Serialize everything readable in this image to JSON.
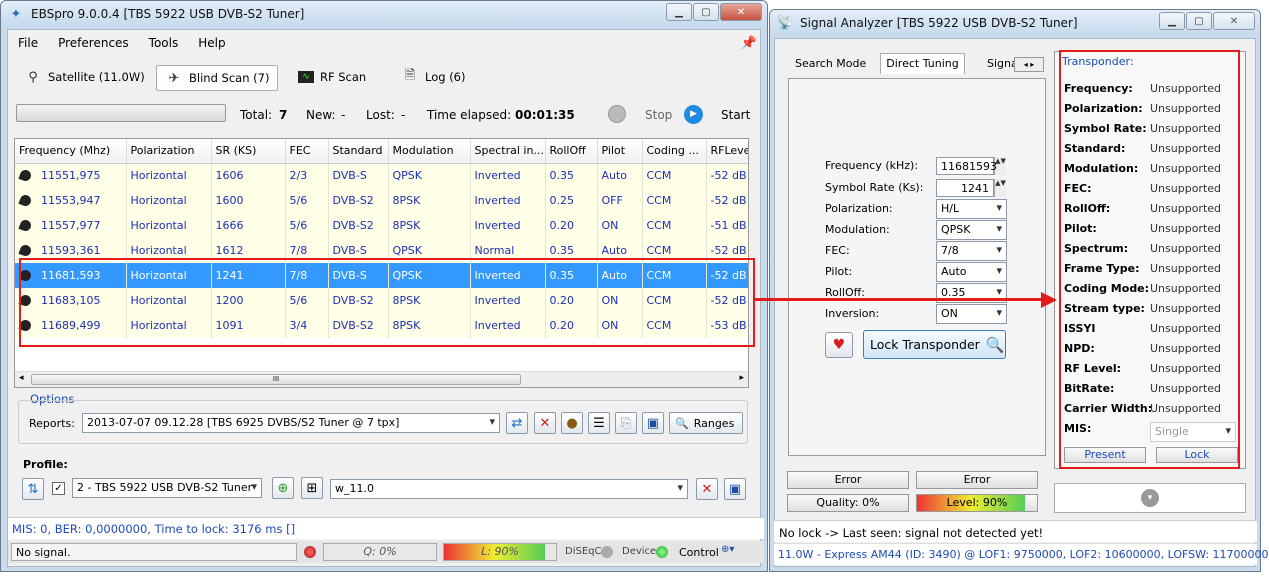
{
  "left": {
    "title": "EBSpro 9.0.0.4 [TBS 5922 USB DVB-S2 Tuner]",
    "menu": [
      "File",
      "Preferences",
      "Tools",
      "Help"
    ],
    "tabs": [
      {
        "label": "Satellite (11.0W)"
      },
      {
        "label": "Blind Scan (7)"
      },
      {
        "label": "RF Scan"
      },
      {
        "label": "Log (6)"
      }
    ],
    "scan": {
      "total_label": "Total:",
      "total": "7",
      "new_label": "New:",
      "new": "-",
      "lost_label": "Lost:",
      "lost": "-",
      "elapsed_label": "Time elapsed:",
      "elapsed": "00:01:35",
      "stop": "Stop",
      "start": "Start"
    },
    "columns": [
      "Frequency (Mhz)",
      "Polarization",
      "SR (KS)",
      "FEC",
      "Standard",
      "Modulation",
      "Spectral in...",
      "RollOff",
      "Pilot",
      "Coding ...",
      "RFLeve"
    ],
    "rows": [
      [
        "11551,975",
        "Horizontal",
        "1606",
        "2/3",
        "DVB-S",
        "QPSK",
        "Inverted",
        "0.35",
        "Auto",
        "CCM",
        "-52 dB"
      ],
      [
        "11553,947",
        "Horizontal",
        "1600",
        "5/6",
        "DVB-S2",
        "8PSK",
        "Inverted",
        "0.25",
        "OFF",
        "CCM",
        "-52 dB"
      ],
      [
        "11557,977",
        "Horizontal",
        "1666",
        "5/6",
        "DVB-S2",
        "8PSK",
        "Inverted",
        "0.20",
        "ON",
        "CCM",
        "-51 dB"
      ],
      [
        "11593,361",
        "Horizontal",
        "1612",
        "7/8",
        "DVB-S",
        "QPSK",
        "Normal",
        "0.35",
        "Auto",
        "CCM",
        "-52 dB"
      ],
      [
        "11681,593",
        "Horizontal",
        "1241",
        "7/8",
        "DVB-S",
        "QPSK",
        "Inverted",
        "0.35",
        "Auto",
        "CCM",
        "-52 dB"
      ],
      [
        "11683,105",
        "Horizontal",
        "1200",
        "5/6",
        "DVB-S2",
        "8PSK",
        "Inverted",
        "0.20",
        "ON",
        "CCM",
        "-52 dB"
      ],
      [
        "11689,499",
        "Horizontal",
        "1091",
        "3/4",
        "DVB-S2",
        "8PSK",
        "Inverted",
        "0.20",
        "ON",
        "CCM",
        "-53 dB"
      ]
    ],
    "scroll_grip": "III",
    "options": {
      "title": "Options",
      "reports_label": "Reports:",
      "report_value": "2013-07-07 09.12.28 [TBS 6925 DVBS/S2 Tuner @ 7 tpx]",
      "ranges": "Ranges"
    },
    "profile": {
      "title": "Profile:",
      "device": "2 - TBS 5922 USB DVB-S2 Tuner",
      "preset": "w_11.0"
    },
    "statusline": "MIS: 0, BER: 0,0000000, Time to lock: 3176 ms []",
    "status": {
      "signal": "No signal.",
      "q": "Q: 0%",
      "l": "L: 90%",
      "level_pct": 90,
      "diseqc": "DiSEqC",
      "device": "Device",
      "control": "Control"
    }
  },
  "right": {
    "title": "Signal Analyzer [TBS 5922 USB DVB-S2 Tuner]",
    "tabs": [
      "Search Mode",
      "Direct Tuning",
      "Signa"
    ],
    "form": [
      {
        "label": "Frequency (kHz):",
        "value": "11681593"
      },
      {
        "label": "Symbol Rate (Ks):",
        "value": "1241"
      },
      {
        "label": "Polarization:",
        "value": "H/L"
      },
      {
        "label": "Modulation:",
        "value": "QPSK"
      },
      {
        "label": "FEC:",
        "value": "7/8"
      },
      {
        "label": "Pilot:",
        "value": "Auto"
      },
      {
        "label": "RollOff:",
        "value": "0.35"
      },
      {
        "label": "Inversion:",
        "value": "ON"
      }
    ],
    "lock_btn": "Lock Transponder",
    "transponder_title": "Transponder:",
    "fields": [
      {
        "k": "Frequency:",
        "v": "Unsupported"
      },
      {
        "k": "Polarization:",
        "v": "Unsupported"
      },
      {
        "k": "Symbol Rate:",
        "v": "Unsupported"
      },
      {
        "k": "Standard:",
        "v": "Unsupported"
      },
      {
        "k": "Modulation:",
        "v": "Unsupported"
      },
      {
        "k": "FEC:",
        "v": "Unsupported"
      },
      {
        "k": "RollOff:",
        "v": "Unsupported"
      },
      {
        "k": "Pilot:",
        "v": "Unsupported"
      },
      {
        "k": "Spectrum:",
        "v": "Unsupported"
      },
      {
        "k": "Frame Type:",
        "v": "Unsupported"
      },
      {
        "k": "Coding Mode:",
        "v": "Unsupported"
      },
      {
        "k": "Stream type:",
        "v": "Unsupported"
      },
      {
        "k": "ISSYI",
        "v": "Unsupported"
      },
      {
        "k": "NPD:",
        "v": "Unsupported"
      },
      {
        "k": "RF Level:",
        "v": "Unsupported"
      },
      {
        "k": "BitRate:",
        "v": "Unsupported"
      },
      {
        "k": "Carrier Width:",
        "v": "Unsupported"
      }
    ],
    "mis_label": "MIS:",
    "mis_value": "Single",
    "present": "Present",
    "lock": "Lock",
    "error1": "Error",
    "error2": "Error",
    "quality": "Quality: 0%",
    "level": "Level: 90%",
    "level_pct": 90,
    "status": "No lock -> Last seen: signal not detected yet!",
    "footer": "11.0W - Express AM44 (ID: 3490) @ LOF1: 9750000, LOF2: 10600000, LOFSW: 11700000"
  },
  "colors": {
    "accent": "#3399ff",
    "arrow": "#e21b1b",
    "link": "#1c2fb5"
  }
}
